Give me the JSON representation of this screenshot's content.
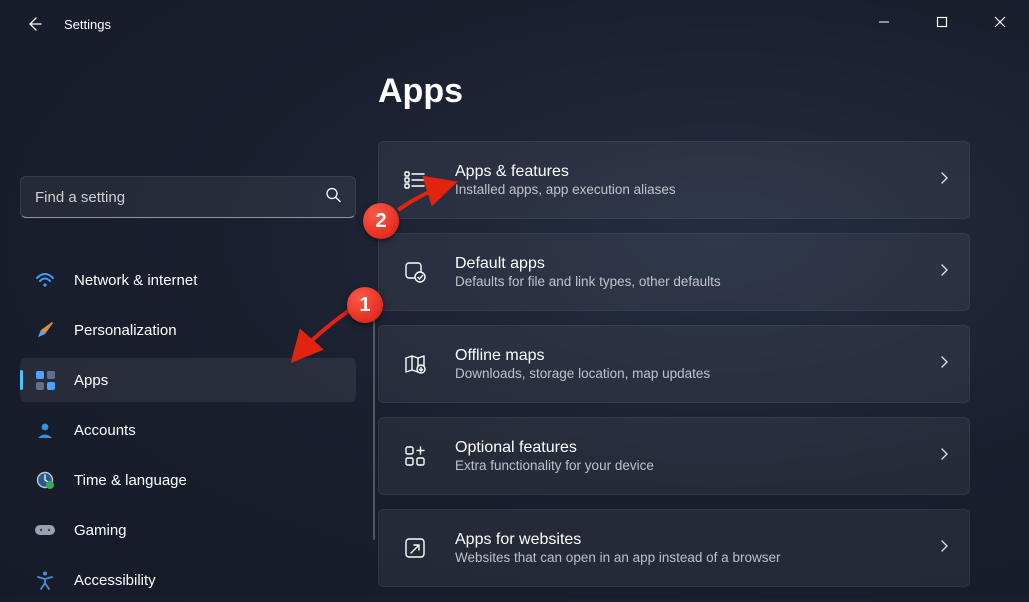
{
  "window": {
    "title": "Settings",
    "controls": {
      "minimize": "minimize",
      "maximize": "maximize",
      "close": "close"
    }
  },
  "search": {
    "placeholder": "Find a setting"
  },
  "sidebar": {
    "items": [
      {
        "id": "network",
        "label": "Network & internet",
        "icon": "wifi-icon",
        "active": false
      },
      {
        "id": "personalization",
        "label": "Personalization",
        "icon": "paintbrush-icon",
        "active": false
      },
      {
        "id": "apps",
        "label": "Apps",
        "icon": "apps-icon",
        "active": true
      },
      {
        "id": "accounts",
        "label": "Accounts",
        "icon": "person-icon",
        "active": false
      },
      {
        "id": "time",
        "label": "Time & language",
        "icon": "clock-globe-icon",
        "active": false
      },
      {
        "id": "gaming",
        "label": "Gaming",
        "icon": "gamepad-icon",
        "active": false
      },
      {
        "id": "accessibility",
        "label": "Accessibility",
        "icon": "accessibility-icon",
        "active": false
      }
    ]
  },
  "page": {
    "title": "Apps"
  },
  "cards": [
    {
      "id": "apps-features",
      "title": "Apps & features",
      "sub": "Installed apps, app execution aliases",
      "icon": "list-icon"
    },
    {
      "id": "default-apps",
      "title": "Default apps",
      "sub": "Defaults for file and link types, other defaults",
      "icon": "default-apps-icon"
    },
    {
      "id": "offline-maps",
      "title": "Offline maps",
      "sub": "Downloads, storage location, map updates",
      "icon": "map-icon"
    },
    {
      "id": "optional",
      "title": "Optional features",
      "sub": "Extra functionality for your device",
      "icon": "grid-plus-icon"
    },
    {
      "id": "apps-websites",
      "title": "Apps for websites",
      "sub": "Websites that can open in an app instead of a browser",
      "icon": "website-icon"
    }
  ],
  "annotations": {
    "marker1": "1",
    "marker2": "2"
  }
}
